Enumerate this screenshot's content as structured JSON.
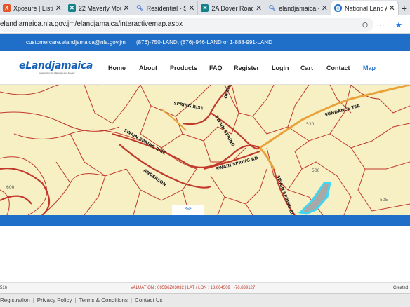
{
  "browser": {
    "tabs": [
      {
        "title": "Xposure | Listin",
        "icon": "xposure-icon",
        "color": "#e6542b",
        "active": false
      },
      {
        "title": "22 Maverly Mou",
        "icon": "x-brand-icon",
        "color": "#13818a",
        "active": false
      },
      {
        "title": "Residential - Sea",
        "icon": "search-icon",
        "color": "#3b6fd4",
        "active": false
      },
      {
        "title": "2A Dover Road",
        "icon": "x-brand-icon",
        "color": "#13818a",
        "active": false
      },
      {
        "title": "elandjamaica - S",
        "icon": "search-icon",
        "color": "#3b6fd4",
        "active": false
      },
      {
        "title": "National Land A",
        "icon": "globe-icon",
        "color": "#1f6ec7",
        "active": true
      }
    ],
    "url": "elandjamaica.nla.gov.jm/elandjamaica/interactivemap.aspx"
  },
  "topbar": {
    "email": "customercare.elandjamaica@nla.gov.jm",
    "phones": "(876)-750-LAND, (876)-946-LAND or 1-888-991-LAND"
  },
  "brand": {
    "logo_text": "eLandjamaica",
    "tagline": "powered by the National Land Agency"
  },
  "nav": {
    "items": [
      "Home",
      "About",
      "Products",
      "FAQ",
      "Register",
      "Login",
      "Cart",
      "Contact",
      "Map"
    ],
    "active": "Map"
  },
  "map": {
    "road_color": "#c0392b",
    "main_road_color": "#e8a23a",
    "parcel_fill": "#f7f0c5",
    "highlight_fill": "#a8a8a8",
    "highlight_stroke": "#3fd7f2",
    "road_labels": [
      "SPRING RISE",
      "ORCHID",
      "SUNDANCE TER",
      "SWAIN SPRING RISE",
      "SWAIN SPRING",
      "ANDERSON",
      "SWAIN SPRING RD",
      "SWAIN SPRING RD"
    ],
    "parcel_numbers": [
      "530",
      "506",
      "600",
      "505"
    ]
  },
  "status": {
    "left": "516",
    "center": "VALUATION : 095B6Z03032 | LAT / LON : 18.064509 , -76.839127",
    "right": "Created"
  },
  "footer": {
    "links": [
      "Registration",
      "Privacy Policy",
      "Terms & Conditions",
      "Contact Us"
    ]
  }
}
